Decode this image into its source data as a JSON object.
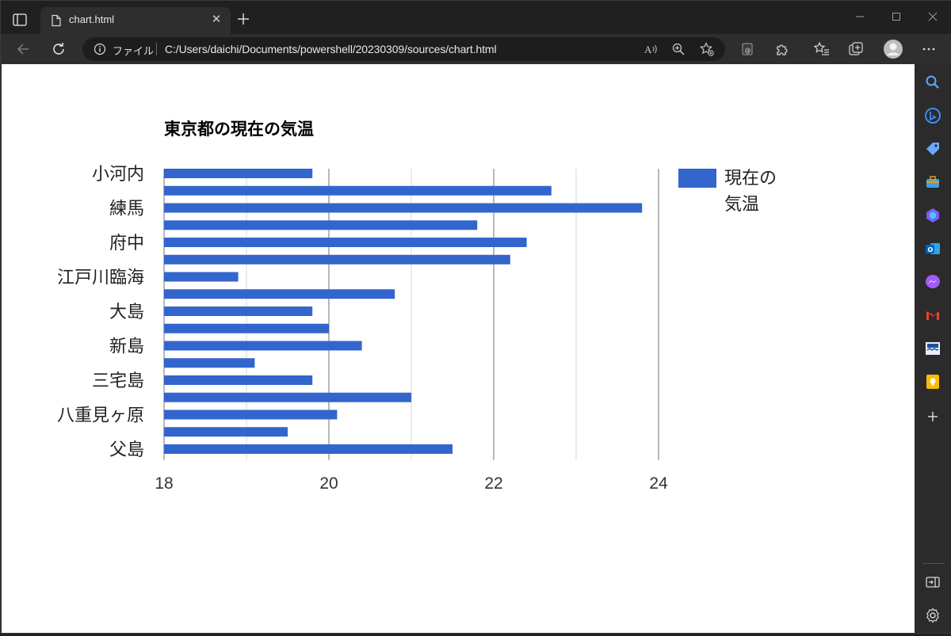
{
  "browser": {
    "tab_title": "chart.html",
    "address_prefix": "ファイル",
    "url": "C:/Users/daichi/Documents/powershell/20230309/sources/chart.html",
    "accent_color": "#3366cc"
  },
  "toolbar": {
    "icons": [
      "back-icon",
      "refresh-icon",
      "info-icon",
      "read-aloud-icon",
      "zoom-icon",
      "add-favorite-icon",
      "extension-icon",
      "puzzle-icon",
      "favorites-icon",
      "collections-icon",
      "profile-icon",
      "more-icon"
    ]
  },
  "sidebar": {
    "icons": [
      "search-icon",
      "bing-icon",
      "shopping-icon",
      "tools-icon",
      "m365-icon",
      "outlook-icon",
      "messenger-icon",
      "gmail-icon",
      "news-icon",
      "keep-icon",
      "add-icon",
      "split-screen-icon",
      "settings-icon"
    ]
  },
  "chart_data": {
    "type": "bar",
    "orientation": "horizontal",
    "title": "東京都の現在の気温",
    "xlim": [
      18,
      24
    ],
    "x_ticks": [
      18,
      20,
      22,
      24
    ],
    "category_labels": [
      "小河内",
      "練馬",
      "府中",
      "江戸川臨海",
      "大島",
      "新島",
      "三宅島",
      "八重見ヶ原",
      "父島"
    ],
    "series": [
      {
        "name": "現在の気温",
        "color": "#3366cc",
        "values": [
          19.8,
          22.7,
          23.8,
          21.8,
          22.4,
          22.2,
          18.9,
          20.8,
          19.8,
          20.0,
          20.4,
          19.1,
          19.8,
          21.0,
          20.1,
          19.5,
          21.5
        ]
      }
    ],
    "legend": {
      "position": "right",
      "label_line1": "現在の",
      "label_line2": "気温"
    },
    "grid": true
  }
}
